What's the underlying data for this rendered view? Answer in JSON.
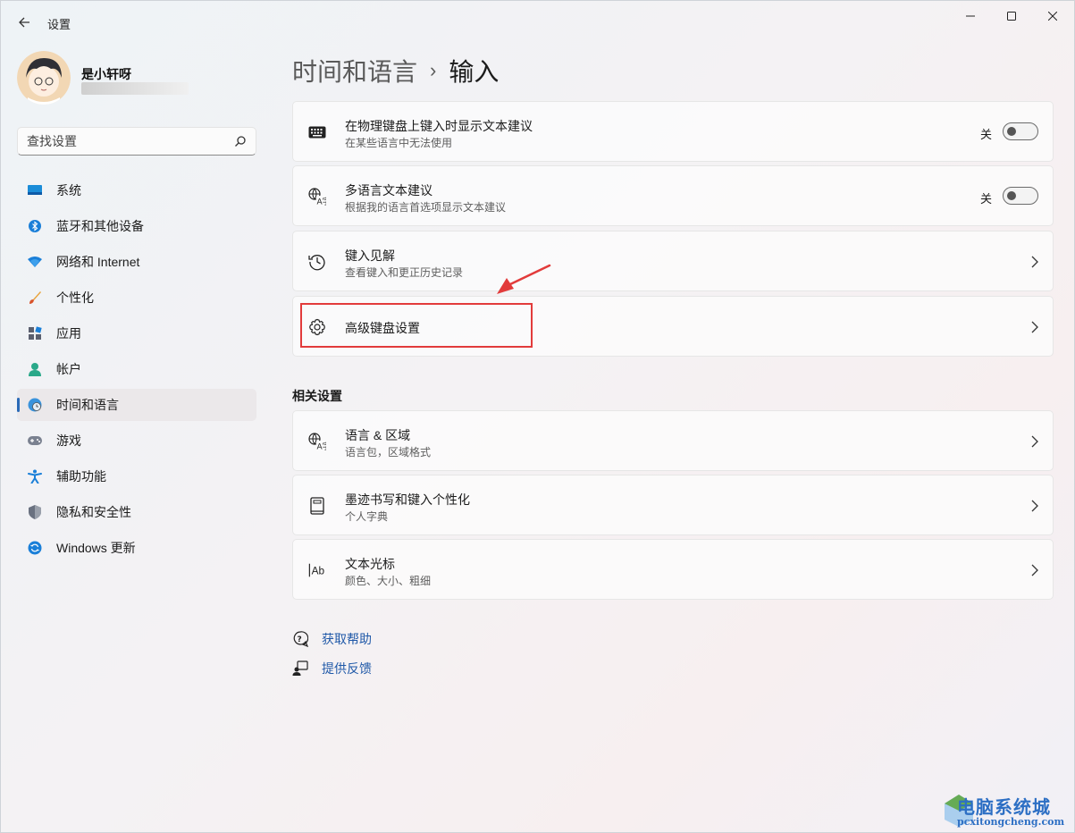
{
  "app": {
    "title": "设置"
  },
  "profile": {
    "name": "是小轩呀"
  },
  "search": {
    "placeholder": "查找设置"
  },
  "nav": {
    "items": [
      {
        "label": "系统",
        "icon": "system-icon"
      },
      {
        "label": "蓝牙和其他设备",
        "icon": "bluetooth-icon"
      },
      {
        "label": "网络和 Internet",
        "icon": "wifi-icon"
      },
      {
        "label": "个性化",
        "icon": "brush-icon"
      },
      {
        "label": "应用",
        "icon": "apps-icon"
      },
      {
        "label": "帐户",
        "icon": "account-icon"
      },
      {
        "label": "时间和语言",
        "icon": "time-language-icon",
        "active": true
      },
      {
        "label": "游戏",
        "icon": "gamepad-icon"
      },
      {
        "label": "辅助功能",
        "icon": "accessibility-icon"
      },
      {
        "label": "隐私和安全性",
        "icon": "shield-icon"
      },
      {
        "label": "Windows 更新",
        "icon": "update-icon"
      }
    ]
  },
  "breadcrumb": {
    "parent": "时间和语言",
    "separator": "›",
    "current": "输入"
  },
  "settings": [
    {
      "title": "在物理键盘上键入时显示文本建议",
      "subtitle": "在某些语言中无法使用",
      "icon": "keyboard-icon",
      "toggle_label": "关",
      "toggle_on": false
    },
    {
      "title": "多语言文本建议",
      "subtitle": "根据我的语言首选项显示文本建议",
      "icon": "language-icon",
      "toggle_label": "关",
      "toggle_on": false
    },
    {
      "title": "键入见解",
      "subtitle": "查看键入和更正历史记录",
      "icon": "history-icon"
    },
    {
      "title": "高级键盘设置",
      "icon": "gear-icon"
    }
  ],
  "related": {
    "title": "相关设置",
    "items": [
      {
        "title": "语言 & 区域",
        "subtitle": "语言包，区域格式",
        "icon": "language-icon"
      },
      {
        "title": "墨迹书写和键入个性化",
        "subtitle": "个人字典",
        "icon": "notebook-icon"
      },
      {
        "title": "文本光标",
        "subtitle": "颜色、大小、粗细",
        "icon": "text-cursor-icon"
      }
    ]
  },
  "help": {
    "get_help": "获取帮助",
    "feedback": "提供反馈"
  },
  "watermark": {
    "title": "电脑系统城",
    "url": "pcxitongcheng.com"
  },
  "colors": {
    "accent": "#2a6ab7",
    "link": "#2059a8",
    "annotation": "#e23b3b"
  }
}
